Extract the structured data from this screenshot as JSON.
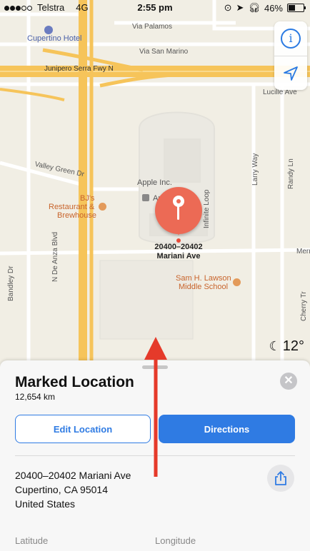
{
  "status_bar": {
    "carrier": "Telstra",
    "network": "4G",
    "time": "2:55 pm",
    "battery": "46%",
    "battery_level": 0.46
  },
  "map": {
    "labels": {
      "hotel": "Cupertino Hotel",
      "via_palamos": "Via Palamos",
      "via_san_marino": "Via San Marino",
      "junipero": "Junipero Serra Fwy N",
      "lucille": "Lucille Ave",
      "valley_green": "Valley Green Dr",
      "apple": "Apple Inc.",
      "apple_inf": "Apple Inf",
      "bjs_1": "BJ's",
      "bjs_2": "Restaurant &",
      "bjs_3": "Brewhouse",
      "n_de_anza": "N De Anza Blvd",
      "infinite_loop": "Infinite Loop",
      "larry_way": "Larry Way",
      "randy_ln": "Randy Ln",
      "merr": "Merr",
      "sam_lawson_1": "Sam H. Lawson",
      "sam_lawson_2": "Middle School",
      "bandley": "Bandley Dr",
      "cherry": "Cherry Tr"
    },
    "pin_label_line1": "20400–20402",
    "pin_label_line2": "Mariani Ave",
    "weather_temp": "12°"
  },
  "sheet": {
    "title": "Marked Location",
    "distance": "12,654 km",
    "edit_label": "Edit Location",
    "directions_label": "Directions",
    "address_line1": "20400–20402 Mariani Ave",
    "address_line2": "Cupertino, CA  95014",
    "address_line3": "United States",
    "latitude_label": "Latitude",
    "longitude_label": "Longitude"
  },
  "colors": {
    "accent": "#2f7be3",
    "pin": "#ec6a55",
    "annotation_arrow": "#e53a2a"
  }
}
